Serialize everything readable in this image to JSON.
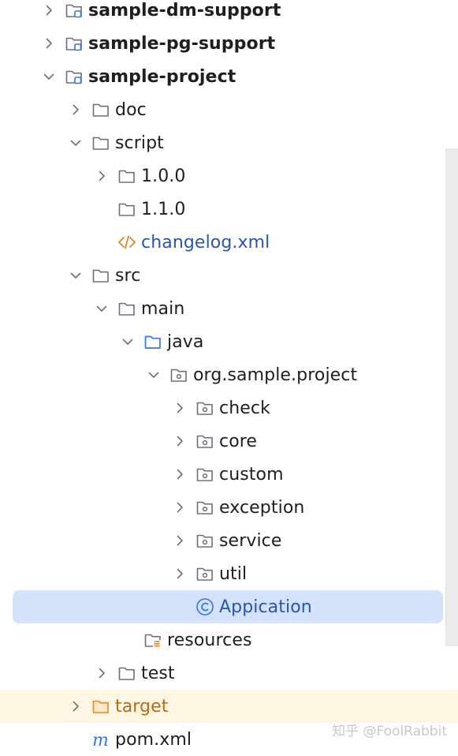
{
  "tree": {
    "rows": [
      {
        "label": "sample-dm-support",
        "icon": "module-folder-icon",
        "bold": true,
        "expanded": false,
        "color": "#1e1e1e"
      },
      {
        "label": "sample-pg-support",
        "icon": "module-folder-icon",
        "bold": true,
        "expanded": false,
        "color": "#1e1e1e"
      },
      {
        "label": "sample-project",
        "icon": "module-folder-icon",
        "bold": true,
        "expanded": true,
        "color": "#1e1e1e"
      },
      {
        "label": "doc",
        "icon": "folder-icon",
        "expanded": false
      },
      {
        "label": "script",
        "icon": "folder-icon",
        "expanded": true
      },
      {
        "label": "1.0.0",
        "icon": "folder-icon",
        "expanded": false
      },
      {
        "label": "1.1.0",
        "icon": "folder-icon"
      },
      {
        "label": "changelog.xml",
        "icon": "xml-file-icon",
        "color": "#2a55b0"
      },
      {
        "label": "src",
        "icon": "folder-icon",
        "expanded": true
      },
      {
        "label": "main",
        "icon": "folder-icon",
        "expanded": true
      },
      {
        "label": "java",
        "icon": "source-root-folder-icon",
        "expanded": true
      },
      {
        "label": "org.sample.project",
        "icon": "package-icon",
        "expanded": true
      },
      {
        "label": "check",
        "icon": "package-icon",
        "expanded": false
      },
      {
        "label": "core",
        "icon": "package-icon",
        "expanded": false
      },
      {
        "label": "custom",
        "icon": "package-icon",
        "expanded": false
      },
      {
        "label": "exception",
        "icon": "package-icon",
        "expanded": false
      },
      {
        "label": "service",
        "icon": "package-icon",
        "expanded": false
      },
      {
        "label": "util",
        "icon": "package-icon",
        "expanded": false
      },
      {
        "label": "Appication",
        "icon": "java-class-icon",
        "selected": true,
        "color": "#2a55b0"
      },
      {
        "label": "resources",
        "icon": "resources-folder-icon"
      },
      {
        "label": "test",
        "icon": "folder-icon",
        "expanded": false
      },
      {
        "label": "target",
        "icon": "excluded-folder-icon",
        "expanded": false,
        "color": "#b86a17",
        "highlight": "#fdf6e3"
      },
      {
        "label": "pom.xml",
        "icon": "maven-icon"
      }
    ]
  },
  "watermark": "知乎 @FoolRabbit",
  "colors": {
    "selection": "#d4e2fb",
    "excluded_row": "#fdf6e3",
    "link_blue": "#2a55b0",
    "excluded_orange": "#b86a17",
    "icon_gray": "#6c707e",
    "source_root_blue": "#3574f0"
  }
}
